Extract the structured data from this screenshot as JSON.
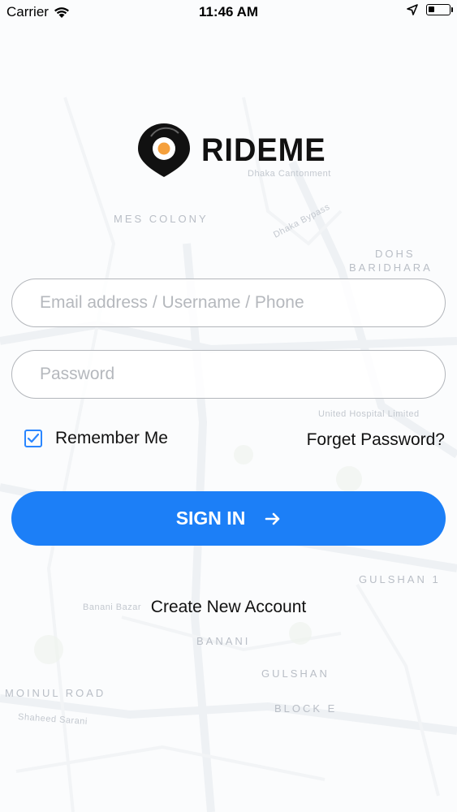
{
  "status_bar": {
    "carrier": "Carrier",
    "time": "11:46 AM"
  },
  "logo": {
    "text": "RIDEME"
  },
  "map_labels": {
    "l1": "MES COLONY",
    "l2": "Dhaka Cantonment",
    "l3": "DOHS",
    "l4": "BARIDHARA",
    "l5": "BANANI",
    "l6": "GULSHAN",
    "l7": "BLOCK E",
    "l8": "MOINUL ROAD",
    "l9": "GULSHAN 1",
    "l10": "Banani Bazar",
    "l11": "Dhaka Bypass",
    "l12": "United Hospital Limited",
    "l13": "Shaheed Sarani"
  },
  "form": {
    "email_placeholder": "Email address / Username / Phone",
    "password_placeholder": "Password",
    "remember_label": "Remember Me",
    "remember_checked": true,
    "forget_label": "Forget Password?",
    "signin_label": "SIGN IN",
    "create_label": "Create New Account"
  },
  "colors": {
    "accent": "#1c7ff7",
    "logo_orange": "#f5a03c",
    "logo_dark": "#111111"
  }
}
